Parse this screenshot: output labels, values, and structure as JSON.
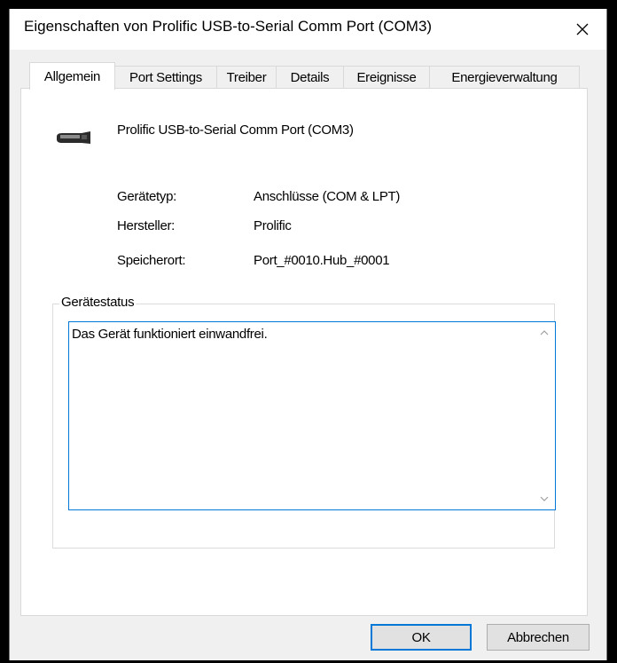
{
  "window": {
    "title": "Eigenschaften von Prolific USB-to-Serial Comm Port (COM3)"
  },
  "tabs": [
    {
      "label": "Allgemein"
    },
    {
      "label": "Port Settings"
    },
    {
      "label": "Treiber"
    },
    {
      "label": "Details"
    },
    {
      "label": "Ereignisse"
    },
    {
      "label": "Energieverwaltung"
    }
  ],
  "device": {
    "name": "Prolific USB-to-Serial Comm Port (COM3)",
    "icon": "serial-port-icon"
  },
  "properties": [
    {
      "label": "Gerätetyp:",
      "value": "Anschlüsse (COM & LPT)"
    },
    {
      "label": "Hersteller:",
      "value": "Prolific"
    },
    {
      "label": "Speicherort:",
      "value": "Port_#0010.Hub_#0001"
    }
  ],
  "status": {
    "group_label": "Gerätestatus",
    "text": "Das Gerät funktioniert einwandfrei."
  },
  "buttons": {
    "ok": "OK",
    "cancel": "Abbrechen"
  },
  "colors": {
    "accent": "#0078d7",
    "background": "#f0f0f0"
  }
}
